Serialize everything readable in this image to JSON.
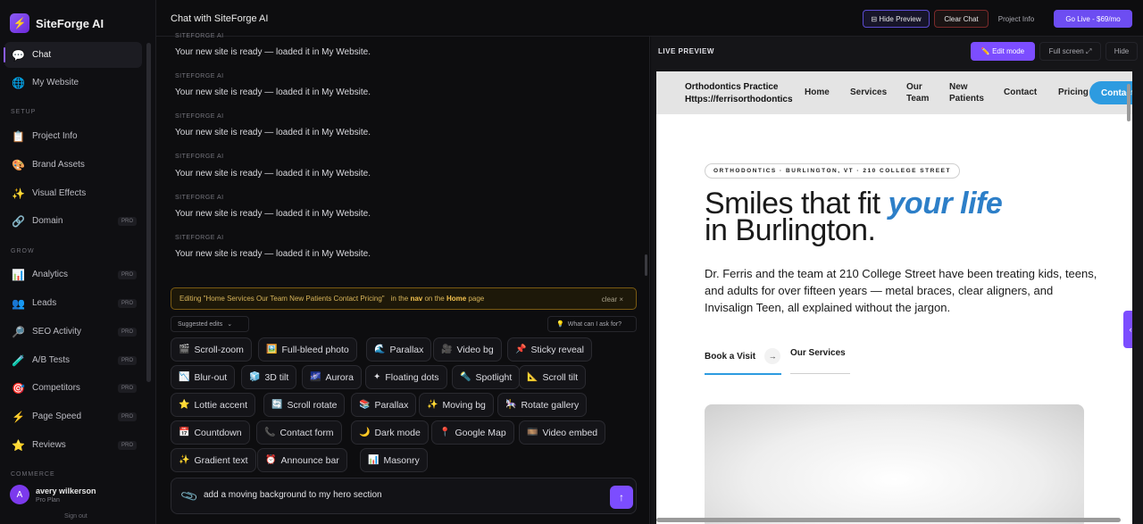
{
  "brand": {
    "name": "SiteForge AI",
    "logo_icon": "⚡"
  },
  "sidebar": {
    "items_top": [
      {
        "label": "Chat",
        "icon": "💬",
        "active": true
      },
      {
        "label": "My Website",
        "icon": "🌐"
      }
    ],
    "setup_label": "SETUP",
    "setup": [
      {
        "label": "Project Info",
        "icon": "📋"
      },
      {
        "label": "Brand Assets",
        "icon": "🎨"
      },
      {
        "label": "Visual Effects",
        "icon": "✨"
      },
      {
        "label": "Domain",
        "icon": "🔗",
        "badge": "PRO"
      }
    ],
    "grow_label": "GROW",
    "grow": [
      {
        "label": "Analytics",
        "icon": "📊",
        "badge": "PRO"
      },
      {
        "label": "Leads",
        "icon": "👥",
        "badge": "PRO"
      },
      {
        "label": "SEO Activity",
        "icon": "🔎",
        "badge": "PRO"
      },
      {
        "label": "A/B Tests",
        "icon": "🧪",
        "badge": "PRO"
      },
      {
        "label": "Competitors",
        "icon": "🎯",
        "badge": "PRO"
      },
      {
        "label": "Page Speed",
        "icon": "⚡",
        "badge": "PRO"
      },
      {
        "label": "Reviews",
        "icon": "⭐",
        "badge": "PRO"
      }
    ],
    "commerce_label": "COMMERCE",
    "user": {
      "initial": "A",
      "name": "avery wilkerson",
      "plan": "Pro Plan"
    },
    "sign_out": "Sign out"
  },
  "topbar": {
    "title": "Chat with SiteForge AI",
    "hide_preview": "⊟ Hide Preview",
    "clear_chat": "Clear Chat",
    "project_info": "Project Info",
    "go_live": "Go Live - $69/mo"
  },
  "chat": {
    "messages": [
      {
        "author": "SITEFORGE AI",
        "text": "Your new site is ready — loaded it in My Website."
      },
      {
        "author": "SITEFORGE AI",
        "text": "Your new site is ready — loaded it in My Website."
      },
      {
        "author": "SITEFORGE AI",
        "text": "Your new site is ready — loaded it in My Website."
      },
      {
        "author": "SITEFORGE AI",
        "text": "Your new site is ready — loaded it in My Website."
      },
      {
        "author": "SITEFORGE AI",
        "text": "Your new site is ready — loaded it in My Website."
      },
      {
        "author": "SITEFORGE AI",
        "text": "Your new site is ready — loaded it in My Website."
      }
    ],
    "editing": {
      "prefix": "Editing \"Home Services Our Team New Patients Contact Pricing\"",
      "in_the": "in the",
      "nav": "nav",
      "on_the": "on the",
      "page_name": "Home",
      "page_word": "page",
      "clear": "clear ×"
    },
    "suggested_edits": "Suggested edits",
    "ask_hint": "What can I ask for?",
    "chips": [
      {
        "icon": "🎬",
        "label": "Scroll-zoom"
      },
      {
        "icon": "🖼️",
        "label": "Full-bleed photo"
      },
      {
        "icon": "🌊",
        "label": "Parallax"
      },
      {
        "icon": "🎥",
        "label": "Video bg"
      },
      {
        "icon": "📌",
        "label": "Sticky reveal"
      },
      {
        "icon": "📉",
        "label": "Blur-out"
      },
      {
        "icon": "🧊",
        "label": "3D tilt"
      },
      {
        "icon": "🌌",
        "label": "Aurora"
      },
      {
        "icon": "✦",
        "label": "Floating dots"
      },
      {
        "icon": "🔦",
        "label": "Spotlight"
      },
      {
        "icon": "📐",
        "label": "Scroll tilt"
      },
      {
        "icon": "⭐",
        "label": "Lottie accent"
      },
      {
        "icon": "🔄",
        "label": "Scroll rotate"
      },
      {
        "icon": "📚",
        "label": "Parallax"
      },
      {
        "icon": "✨",
        "label": "Moving bg"
      },
      {
        "icon": "🎠",
        "label": "Rotate gallery"
      },
      {
        "icon": "📅",
        "label": "Countdown"
      },
      {
        "icon": "📞",
        "label": "Contact form"
      },
      {
        "icon": "🌙",
        "label": "Dark mode"
      },
      {
        "icon": "📍",
        "label": "Google Map"
      },
      {
        "icon": "🎞️",
        "label": "Video embed"
      },
      {
        "icon": "✨",
        "label": "Gradient text"
      },
      {
        "icon": "⏰",
        "label": "Announce bar"
      },
      {
        "icon": "📊",
        "label": "Masonry"
      }
    ],
    "input_value": "add a moving background to my hero section"
  },
  "preview": {
    "label": "LIVE PREVIEW",
    "edit_mode": "✏️ Edit mode",
    "full_screen": "Full screen ⤢",
    "hide": "Hide",
    "site": {
      "brand_line1": "Orthodontics Practice",
      "brand_line2": "Https://ferrisorthodontics",
      "nav": [
        "Home",
        "Services",
        "Our Team",
        "New Patients",
        "Contact",
        "Pricing"
      ],
      "nav_cta": "Contact",
      "pill": "ORTHODONTICS · BURLINGTON, VT · 210 COLLEGE STREET",
      "title_a": "Smiles that fit ",
      "title_em": "your life",
      "title_b": "in Burlington.",
      "paragraph": "Dr. Ferris and the team at 210 College Street have been treating kids, teens, and adults for over fifteen years — metal braces, clear aligners, and Invisalign Teen, all explained without the jargon.",
      "cta_primary": "Book a Visit",
      "cta_secondary": "Our Services"
    }
  },
  "colors": {
    "accent": "#7c4dff",
    "site_blue": "#2d9be0"
  }
}
